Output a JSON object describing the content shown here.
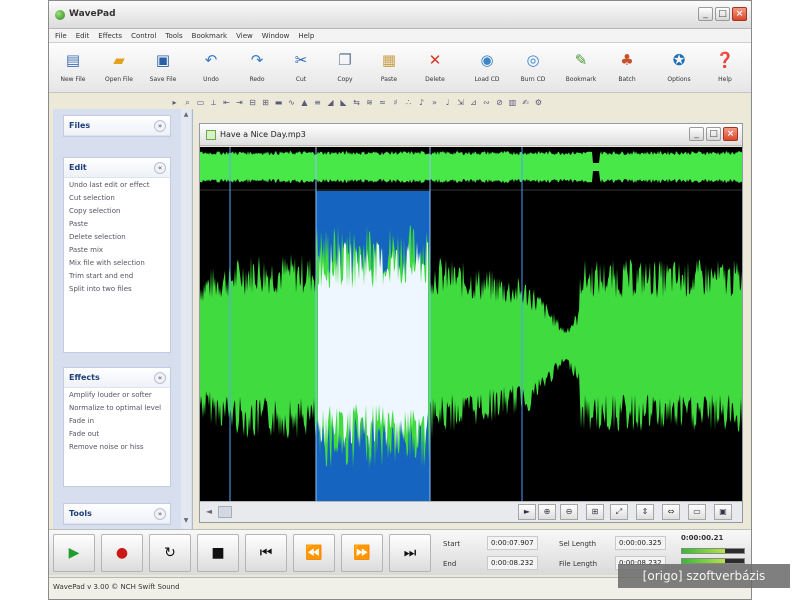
{
  "window": {
    "title": "WavePad"
  },
  "menu": [
    "File",
    "Edit",
    "Effects",
    "Control",
    "Tools",
    "Bookmark",
    "View",
    "Window",
    "Help"
  ],
  "toolbar": [
    {
      "label": "New File",
      "icon": "new-file-icon"
    },
    {
      "label": "Open File",
      "icon": "open-file-icon"
    },
    {
      "label": "Save File",
      "icon": "save-icon"
    },
    {
      "label": "Undo",
      "icon": "undo-icon"
    },
    {
      "label": "Redo",
      "icon": "redo-icon"
    },
    {
      "label": "Cut",
      "icon": "cut-icon"
    },
    {
      "label": "Copy",
      "icon": "copy-icon"
    },
    {
      "label": "Paste",
      "icon": "paste-icon"
    },
    {
      "label": "Delete",
      "icon": "delete-icon"
    },
    {
      "label": "Load CD",
      "icon": "load-cd-icon"
    },
    {
      "label": "Burn CD",
      "icon": "burn-cd-icon"
    },
    {
      "label": "Bookmark",
      "icon": "bookmark-icon"
    },
    {
      "label": "Batch",
      "icon": "batch-icon"
    },
    {
      "label": "Options",
      "icon": "options-icon"
    },
    {
      "label": "Help",
      "icon": "help-icon"
    }
  ],
  "sidebar": {
    "panels": [
      {
        "title": "Files",
        "items": []
      },
      {
        "title": "Edit",
        "items": [
          "Undo last edit or effect",
          "Cut selection",
          "Copy selection",
          "Paste",
          "Delete selection",
          "Paste mix",
          "Mix file with selection",
          "Trim start and end",
          "Split into two files"
        ]
      },
      {
        "title": "Effects",
        "items": [
          "Amplify louder or softer",
          "Normalize to optimal level",
          "Fade in",
          "Fade out",
          "Remove noise or hiss"
        ]
      },
      {
        "title": "Tools",
        "items": []
      }
    ]
  },
  "wave_window": {
    "title": "Have a Nice Day.mp3"
  },
  "transport": {
    "labels": {
      "start": "Start",
      "end": "End",
      "sel_length": "Sel Length",
      "file_length": "File Length"
    },
    "values": {
      "start": "0:00:07.907",
      "end": "0:00:08.232",
      "sel_length": "0:00:00.325",
      "file_length": "0:00:08.232"
    },
    "clock": "0:00:00.21",
    "level": 0.7
  },
  "status": {
    "text": "WavePad v 3.00 © NCH Swift Sound"
  },
  "watermark": {
    "text": "[origo] szoftverbázis"
  }
}
